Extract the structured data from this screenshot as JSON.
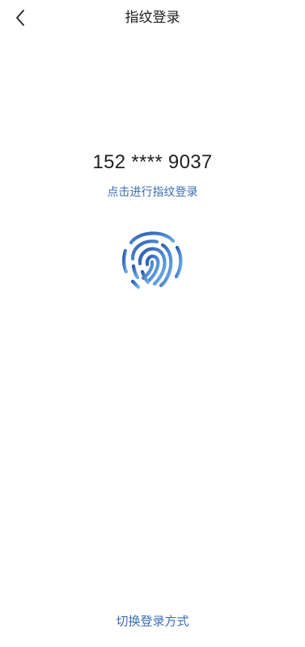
{
  "header": {
    "title": "指纹登录",
    "back_icon": "chevron-left-icon"
  },
  "main": {
    "phone_number": "152 **** 9037",
    "hint": "点击进行指纹登录",
    "fingerprint_icon": "fingerprint-icon"
  },
  "footer": {
    "switch_label": "切换登录方式"
  },
  "colors": {
    "accent": "#3a6db3",
    "fingerprint_start": "#2a5bb0",
    "fingerprint_end": "#6fb0ea",
    "text": "#222222",
    "background": "#ffffff"
  }
}
